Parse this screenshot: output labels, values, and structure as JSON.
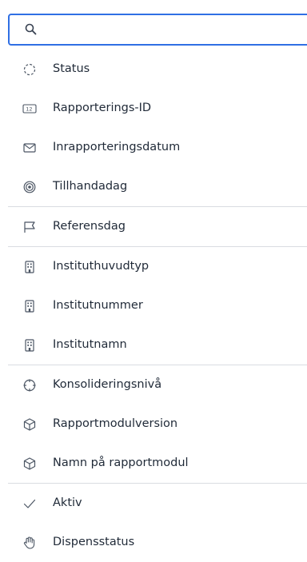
{
  "search": {
    "value": "",
    "placeholder": ""
  },
  "items": [
    {
      "label": "Status",
      "icon": "dashed-circle-icon",
      "name": "status"
    },
    {
      "label": "Rapporterings-ID",
      "icon": "number-12-icon",
      "name": "rapporterings-id"
    },
    {
      "label": "Inrapporteringsdatum",
      "icon": "envelope-icon",
      "name": "inrapporteringsdatum"
    },
    {
      "label": "Tillhandadag",
      "icon": "target-icon",
      "name": "tillhandadag"
    },
    {
      "label": "Referensdag",
      "icon": "flag-icon",
      "name": "referensdag"
    },
    {
      "label": "Instituthuvudtyp",
      "icon": "building-icon",
      "name": "instituthuvudtyp"
    },
    {
      "label": "Institutnummer",
      "icon": "building-icon",
      "name": "institutnummer"
    },
    {
      "label": "Institutnamn",
      "icon": "building-icon",
      "name": "institutnamn"
    },
    {
      "label": "Konsolideringsnivå",
      "icon": "crosshair-icon",
      "name": "konsolideringsniva"
    },
    {
      "label": "Rapportmodulversion",
      "icon": "cube-icon",
      "name": "rapportmodulversion"
    },
    {
      "label": "Namn på rapportmodul",
      "icon": "cube-icon",
      "name": "namn-pa-rapportmodul"
    },
    {
      "label": "Aktiv",
      "icon": "checkmark-icon",
      "name": "aktiv"
    },
    {
      "label": "Dispensstatus",
      "icon": "hand-icon",
      "name": "dispensstatus"
    }
  ],
  "colors": {
    "accent": "#2f6fe4",
    "divider": "#d9dce1",
    "icon": "#4b5563",
    "text": "#1f2937"
  }
}
